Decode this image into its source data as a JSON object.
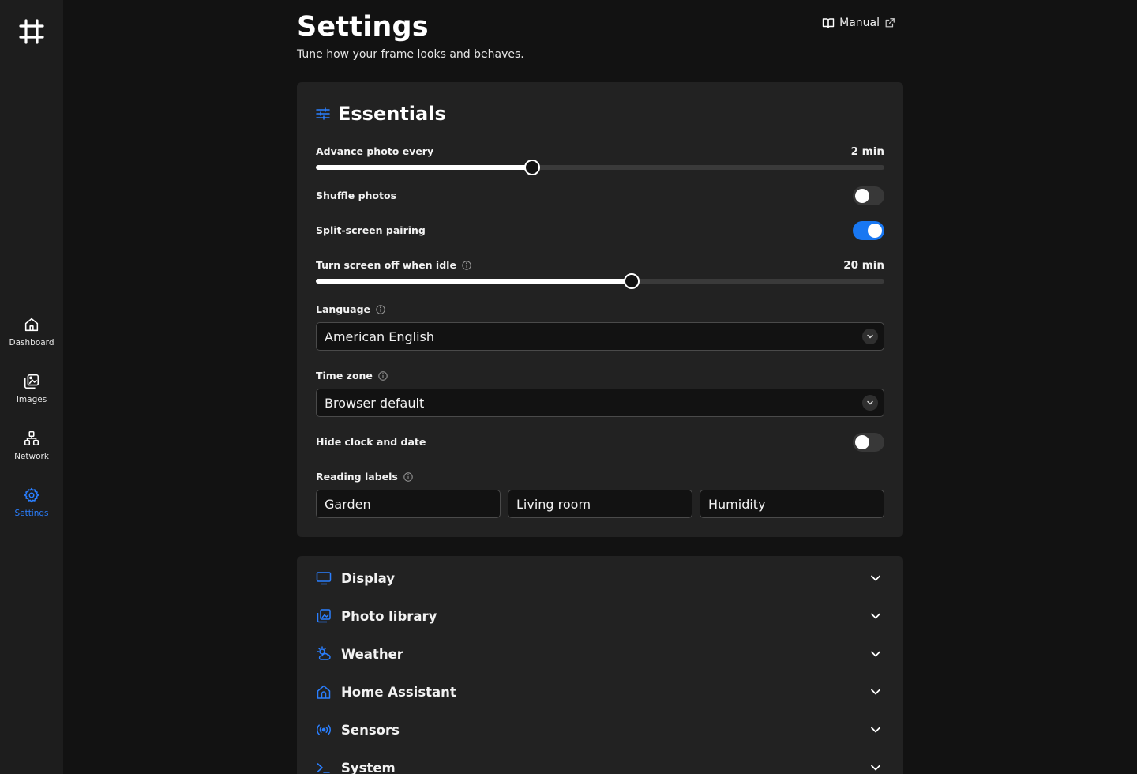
{
  "sidebar": {
    "items": [
      {
        "label": "Dashboard",
        "icon": "home-icon"
      },
      {
        "label": "Images",
        "icon": "images-icon"
      },
      {
        "label": "Network",
        "icon": "network-icon"
      },
      {
        "label": "Settings",
        "icon": "gear-icon",
        "active": true
      }
    ]
  },
  "header": {
    "title": "Settings",
    "subtitle": "Tune how your frame looks and behaves.",
    "manual_label": "Manual"
  },
  "essentials": {
    "title": "Essentials",
    "advance_photo": {
      "label": "Advance photo every",
      "value": "2 min",
      "slider_fraction": 0.38
    },
    "shuffle": {
      "label": "Shuffle photos",
      "on": false
    },
    "split_screen": {
      "label": "Split-screen pairing",
      "on": true
    },
    "screen_off": {
      "label": "Turn screen off when idle",
      "value": "20 min",
      "slider_fraction": 0.555
    },
    "language": {
      "label": "Language",
      "value": "American English"
    },
    "timezone": {
      "label": "Time zone",
      "value": "Browser default"
    },
    "hide_clock": {
      "label": "Hide clock and date",
      "on": false
    },
    "reading_labels": {
      "label": "Reading labels",
      "values": [
        "Garden",
        "Living room",
        "Humidity"
      ]
    }
  },
  "sections": [
    {
      "label": "Display",
      "icon": "monitor-icon"
    },
    {
      "label": "Photo library",
      "icon": "photo-library-icon"
    },
    {
      "label": "Weather",
      "icon": "weather-icon"
    },
    {
      "label": "Home Assistant",
      "icon": "home-assistant-icon"
    },
    {
      "label": "Sensors",
      "icon": "sensors-icon"
    },
    {
      "label": "System",
      "icon": "terminal-icon"
    }
  ],
  "colors": {
    "accent": "#2a7fff",
    "toggle_on": "#1877f2",
    "background": "#121212",
    "card": "#222222",
    "sidebar": "#1d1d1d"
  }
}
